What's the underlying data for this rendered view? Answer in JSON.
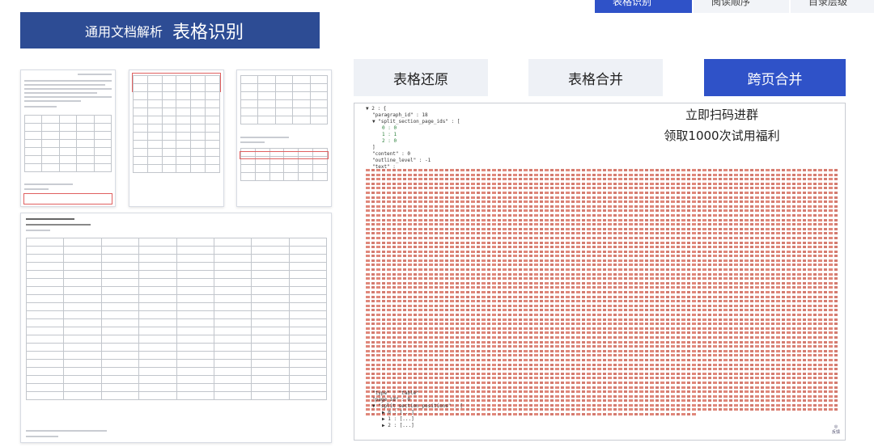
{
  "top_tabs": [
    "表格识别",
    "阅读顺序",
    "目录层级"
  ],
  "banner": {
    "sub": "通用文档解析",
    "main": "表格识别"
  },
  "features": [
    "表格还原",
    "表格合并",
    "跨页合并"
  ],
  "json": {
    "open": "▼ 2 : {",
    "paragraph_id": "\"paragraph_id\" : 18",
    "split_section_page_ids": "▼ \"split_section_page_ids\" : [",
    "ids": [
      "0 : 0",
      "1 : 1",
      "2 : 0"
    ],
    "close_bracket": "]",
    "content": "\"content\" : 0",
    "outline_level": "\"outline_level\" : -1",
    "text_key": "\"text\" :",
    "type": "\"type\" : \"table\"",
    "page_id": "\"page_id\" : 0",
    "positions_key": "▼ \"split_section_positions\" : [",
    "positions": [
      "▶ 0 : [...]",
      "▶ 1 : [...]",
      "▶ 2 : [...]"
    ]
  },
  "promo": {
    "line1": "立即扫码进群",
    "line2": "领取1000次试用福利"
  },
  "side_button": "反馈"
}
